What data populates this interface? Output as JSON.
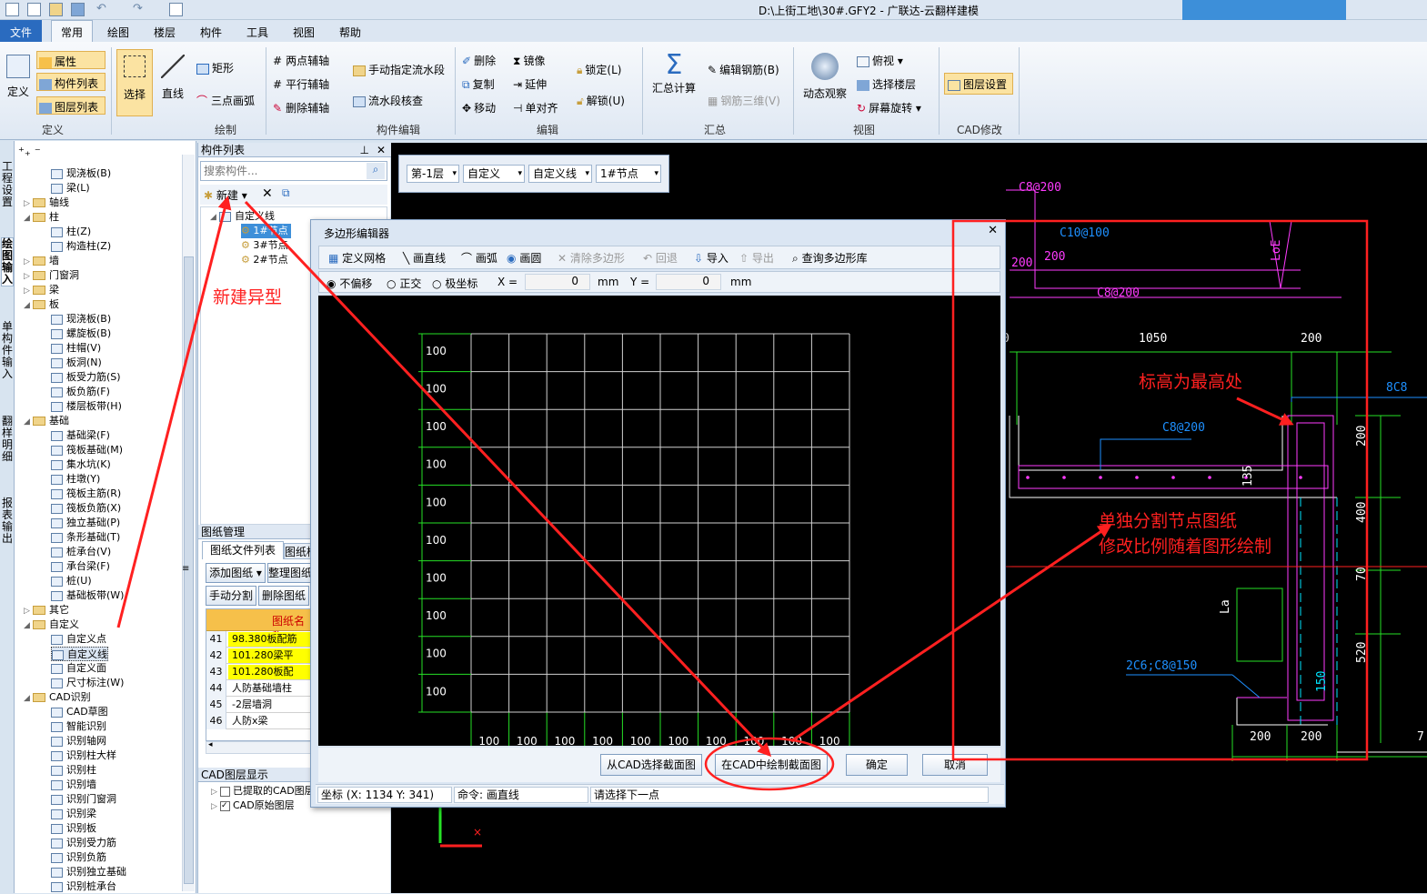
{
  "title": "D:\\上街工地\\30#.GFY2 - 广联达-云翻样建模",
  "menu": [
    "文件",
    "常用",
    "绘图",
    "楼层",
    "构件",
    "工具",
    "视图",
    "帮助"
  ],
  "ribbon": {
    "define": {
      "big": "定义",
      "items": [
        "属性",
        "构件列表",
        "图层列表"
      ],
      "label": "定义"
    },
    "draw": {
      "select": "选择",
      "line": "直线",
      "rect": "矩形",
      "arc3": "三点画弧",
      "label": "绘制"
    },
    "aux": {
      "items": [
        "两点辅轴",
        "平行辅轴",
        "删除辅轴"
      ]
    },
    "compedit": {
      "items": [
        "手动指定流水段",
        "流水段核查"
      ],
      "label": "构件编辑"
    },
    "edit": {
      "col1": [
        "删除",
        "复制",
        "移动"
      ],
      "col2": [
        "镜像",
        "延伸",
        "单对齐"
      ],
      "lock": [
        "锁定(L)",
        "解锁(U)"
      ],
      "label": "编辑"
    },
    "summary": {
      "calc": "汇总计算",
      "edit_rebar": "编辑钢筋(B)",
      "rebar3d": "钢筋三维(V)",
      "label": "汇总"
    },
    "view": {
      "dyn": "动态观察",
      "items": [
        "俯视",
        "选择楼层",
        "屏幕旋转"
      ],
      "label": "视图"
    },
    "cad": {
      "layer": "图层设置",
      "label": "CAD修改"
    }
  },
  "left_tabs": [
    "工程设置",
    "绘图输入",
    "单构件输入",
    "翻样明细",
    "报表输出"
  ],
  "tree": [
    {
      "t": "现浇板(B)",
      "lv": 2
    },
    {
      "t": "梁(L)",
      "lv": 2
    },
    {
      "t": "轴线",
      "lv": 1,
      "f": 1,
      "e": "▷"
    },
    {
      "t": "柱",
      "lv": 1,
      "f": 1,
      "e": "◢"
    },
    {
      "t": "柱(Z)",
      "lv": 2
    },
    {
      "t": "构造柱(Z)",
      "lv": 2
    },
    {
      "t": "墙",
      "lv": 1,
      "f": 1,
      "e": "▷"
    },
    {
      "t": "门窗洞",
      "lv": 1,
      "f": 1,
      "e": "▷"
    },
    {
      "t": "梁",
      "lv": 1,
      "f": 1,
      "e": "▷"
    },
    {
      "t": "板",
      "lv": 1,
      "f": 1,
      "e": "◢"
    },
    {
      "t": "现浇板(B)",
      "lv": 2
    },
    {
      "t": "螺旋板(B)",
      "lv": 2
    },
    {
      "t": "柱帽(V)",
      "lv": 2
    },
    {
      "t": "板洞(N)",
      "lv": 2
    },
    {
      "t": "板受力筋(S)",
      "lv": 2
    },
    {
      "t": "板负筋(F)",
      "lv": 2
    },
    {
      "t": "楼层板带(H)",
      "lv": 2
    },
    {
      "t": "基础",
      "lv": 1,
      "f": 1,
      "e": "◢"
    },
    {
      "t": "基础梁(F)",
      "lv": 2
    },
    {
      "t": "筏板基础(M)",
      "lv": 2
    },
    {
      "t": "集水坑(K)",
      "lv": 2
    },
    {
      "t": "柱墩(Y)",
      "lv": 2
    },
    {
      "t": "筏板主筋(R)",
      "lv": 2
    },
    {
      "t": "筏板负筋(X)",
      "lv": 2
    },
    {
      "t": "独立基础(P)",
      "lv": 2
    },
    {
      "t": "条形基础(T)",
      "lv": 2
    },
    {
      "t": "桩承台(V)",
      "lv": 2
    },
    {
      "t": "承台梁(F)",
      "lv": 2
    },
    {
      "t": "桩(U)",
      "lv": 2
    },
    {
      "t": "基础板带(W)",
      "lv": 2
    },
    {
      "t": "其它",
      "lv": 1,
      "f": 1,
      "e": "▷"
    },
    {
      "t": "自定义",
      "lv": 1,
      "f": 1,
      "e": "◢"
    },
    {
      "t": "自定义点",
      "lv": 2
    },
    {
      "t": "自定义线",
      "lv": 2,
      "sel": 1
    },
    {
      "t": "自定义面",
      "lv": 2
    },
    {
      "t": "尺寸标注(W)",
      "lv": 2
    },
    {
      "t": "CAD识别",
      "lv": 1,
      "f": 1,
      "e": "◢"
    },
    {
      "t": "CAD草图",
      "lv": 2
    },
    {
      "t": "智能识别",
      "lv": 2
    },
    {
      "t": "识别轴网",
      "lv": 2
    },
    {
      "t": "识别柱大样",
      "lv": 2
    },
    {
      "t": "识别柱",
      "lv": 2
    },
    {
      "t": "识别墙",
      "lv": 2
    },
    {
      "t": "识别门窗洞",
      "lv": 2
    },
    {
      "t": "识别梁",
      "lv": 2
    },
    {
      "t": "识别板",
      "lv": 2
    },
    {
      "t": "识别受力筋",
      "lv": 2
    },
    {
      "t": "识别负筋",
      "lv": 2
    },
    {
      "t": "识别独立基础",
      "lv": 2
    },
    {
      "t": "识别桩承台",
      "lv": 2
    }
  ],
  "comp": {
    "title": "构件列表",
    "search_ph": "搜索构件...",
    "new": "新建",
    "root": "自定义线",
    "items": [
      "1#节点",
      "3#节点",
      "2#节点"
    ]
  },
  "drawing": {
    "title": "图纸管理",
    "tab1": "图纸文件列表",
    "tab2": "图纸楼",
    "btn1": "添加图纸",
    "btn2": "整理图纸",
    "btn3": "手动分割",
    "btn4": "删除图纸",
    "col": "图纸名称",
    "rows": [
      {
        "n": "41",
        "v": "98.380板配筋",
        "y": 1
      },
      {
        "n": "42",
        "v": "101.280梁平",
        "y": 1
      },
      {
        "n": "43",
        "v": "101.280板配",
        "y": 1
      },
      {
        "n": "44",
        "v": "人防基础墙柱",
        "y": 0
      },
      {
        "n": "45",
        "v": "-2层墙洞",
        "y": 0
      },
      {
        "n": "46",
        "v": "人防x梁",
        "y": 0
      }
    ]
  },
  "cadlayer": {
    "title": "CAD图层显示",
    "items": [
      "已提取的CAD图层",
      "CAD原始图层"
    ]
  },
  "layerbar": {
    "floor": "第-1层",
    "type": "自定义",
    "sub": "自定义线",
    "node": "1#节点"
  },
  "dialog": {
    "title": "多边形编辑器",
    "tb": [
      "定义网格",
      "画直线",
      "画弧",
      "画圆",
      "清除多边形",
      "回退",
      "导入",
      "导出",
      "查询多边形库"
    ],
    "modes": [
      "不偏移",
      "正交",
      "极坐标"
    ],
    "x_label": "X =",
    "x_val": "0",
    "y_label": "Y =",
    "y_val": "0",
    "unit": "mm",
    "grid_label": "100",
    "b_from": "从CAD选择截面图",
    "b_draw": "在CAD中绘制截面图",
    "b_ok": "确定",
    "b_cancel": "取消",
    "st_coord": "坐标 (X: 1134 Y: 341)",
    "st_cmd": "命令: 画直线",
    "st_hint": "请选择下一点"
  },
  "cad_text": {
    "c1": "C8@200",
    "c2": "C10@100",
    "c3": "200",
    "c4": "200",
    "c5": "LoE",
    "c6": "C8@200",
    "d0": "0",
    "d1": "1050",
    "d2": "200",
    "c7": "8C8",
    "c8": "C8@200",
    "d3": "135",
    "d4": "200",
    "d5": "400",
    "d6": "70",
    "d7": "La",
    "d8": "2C6;C8@150",
    "d9": "150",
    "d10": "520",
    "d11": "200",
    "d12": "200",
    "d13": "7"
  },
  "annotations": {
    "a1": "新建异型",
    "a2": "标高为最高处",
    "a3": "单独分割节点图纸",
    "a4": "修改比例随着图形绘制"
  }
}
